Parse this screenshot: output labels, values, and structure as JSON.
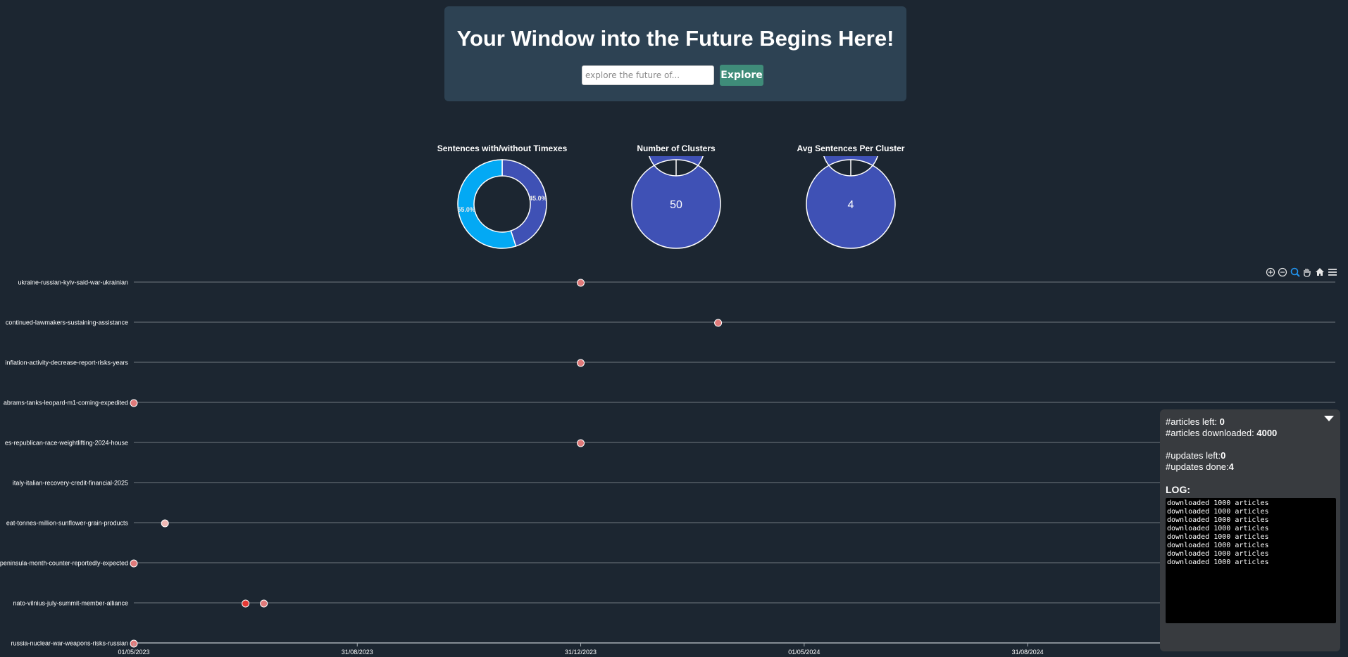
{
  "hero": {
    "title": "Your Window into the Future Begins Here!",
    "search_placeholder": "explore the future of...",
    "explore_label": "Explore"
  },
  "colors": {
    "background": "#1c2631",
    "panel": "#2d4253",
    "accent_button": "#3f8c79",
    "donut_primary": "#3f51b5",
    "donut_secondary": "#03a9f4",
    "point_default": "#e07a7a",
    "point_dark": "#e53935",
    "point_light": "#f0b8b4"
  },
  "toolbar_icons": [
    "zoom-in-icon",
    "zoom-out-icon",
    "selection-zoom-icon",
    "pan-icon",
    "home-icon",
    "menu-icon"
  ],
  "log": {
    "articles_left_label": "#articles left: ",
    "articles_left_value": "0",
    "articles_downloaded_label": "#articles downloaded: ",
    "articles_downloaded_value": "4000",
    "updates_left_label": "#updates left:",
    "updates_left_value": "0",
    "updates_done_label": "#updates done:",
    "updates_done_value": "4",
    "title": "LOG:",
    "lines": [
      "downloaded 1000 articles",
      "downloaded 1000 articles",
      "downloaded 1000 articles",
      "downloaded 1000 articles",
      "downloaded 1000 articles",
      "downloaded 1000 articles",
      "downloaded 1000 articles",
      "downloaded 1000 articles"
    ]
  },
  "chart_data": [
    {
      "type": "pie",
      "variant": "donut",
      "title": "Sentences with/without Timexes",
      "slices": [
        {
          "value": 45.0,
          "label": "45.0%",
          "color": "#3f51b5"
        },
        {
          "value": 55.0,
          "label": "55.0%",
          "color": "#03a9f4"
        }
      ]
    },
    {
      "type": "pie",
      "variant": "donut",
      "title": "Number of Clusters",
      "center_label": "50",
      "slices": [
        {
          "value": 100,
          "color": "#3f51b5"
        }
      ]
    },
    {
      "type": "pie",
      "variant": "donut",
      "title": "Avg Sentences Per Cluster",
      "center_label": "4",
      "slices": [
        {
          "value": 100,
          "color": "#3f51b5"
        }
      ]
    },
    {
      "type": "scatter",
      "x_type": "datetime",
      "x_ticks": [
        "01/05/2023",
        "31/08/2023",
        "31/12/2023",
        "01/05/2024",
        "31/08/2024"
      ],
      "xlim": [
        "2023-05-01",
        "2025-02-15"
      ],
      "grid": true,
      "categories": [
        {
          "label": "ukraine-russian-kyiv-said-war-ukrainian",
          "points": [
            {
              "x": "2023-12-31",
              "tone": "default"
            }
          ]
        },
        {
          "label": "continued-lawmakers-sustaining-assistance",
          "points": [
            {
              "x": "2024-03-15",
              "tone": "default"
            }
          ]
        },
        {
          "label": "inflation-activity-decrease-report-risks-years",
          "points": [
            {
              "x": "2023-12-31",
              "tone": "default"
            }
          ]
        },
        {
          "label": "abrams-tanks-leopard-m1-coming-expedited",
          "points": [
            {
              "x": "2023-05-01",
              "tone": "default"
            }
          ]
        },
        {
          "label": "es-republican-race-weightlifting-2024-house",
          "points": [
            {
              "x": "2023-12-31",
              "tone": "default"
            }
          ]
        },
        {
          "label": "italy-italian-recovery-credit-financial-2025",
          "points": []
        },
        {
          "label": "eat-tonnes-million-sunflower-grain-products",
          "points": [
            {
              "x": "2023-05-18",
              "tone": "light"
            }
          ]
        },
        {
          "label": "peninsula-month-counter-reportedly-expected",
          "points": [
            {
              "x": "2023-05-01",
              "tone": "default"
            }
          ]
        },
        {
          "label": "nato-vilnius-july-summit-member-alliance",
          "points": [
            {
              "x": "2023-07-01",
              "tone": "dark"
            },
            {
              "x": "2023-07-11",
              "tone": "default"
            }
          ]
        },
        {
          "label": "russia-nuclear-war-weapons-risks-russian",
          "points": [
            {
              "x": "2023-05-01",
              "tone": "default"
            }
          ]
        }
      ]
    }
  ]
}
